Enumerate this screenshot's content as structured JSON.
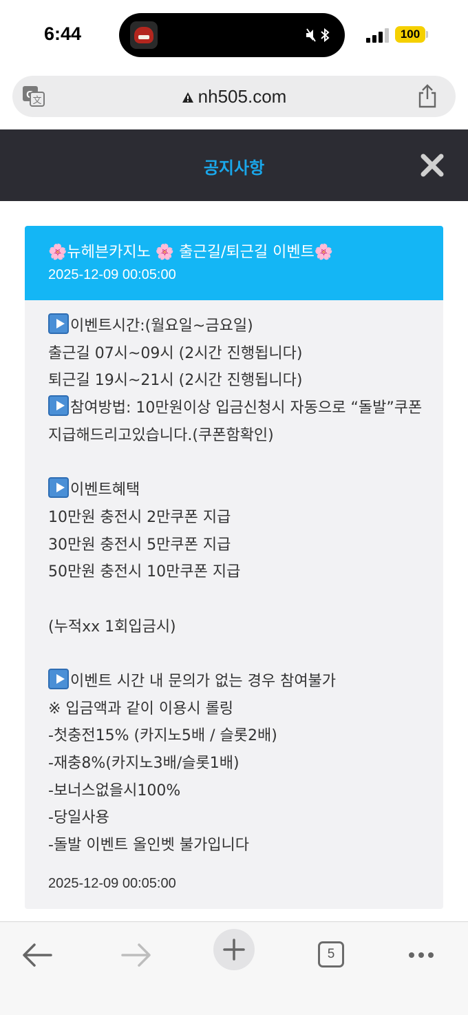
{
  "status_bar": {
    "time": "6:44",
    "battery": "100"
  },
  "browser": {
    "url": "nh505.com"
  },
  "modal": {
    "title": "공지사항"
  },
  "notice": {
    "title_segments": [
      "🌸",
      "뉴헤븐카지노 ",
      "🌸",
      " 출근길/퇴근길 이벤트",
      "🌸"
    ],
    "date": "2025-12-09 00:05:00",
    "body": [
      {
        "play": true,
        "text": "이벤트시간:(월요일~금요일)"
      },
      {
        "play": false,
        "text": "출근길 07시~09시 (2시간 진행됩니다)"
      },
      {
        "play": false,
        "text": "퇴근길 19시~21시 (2시간 진행됩니다)"
      },
      {
        "play": true,
        "text": "참여방법: 10만원이상 입금신청시  자동으로 “돌발”쿠폰 지급해드리고있습니다.(쿠폰함확인)",
        "wrap": true
      },
      {
        "play": false,
        "text": ""
      },
      {
        "play": true,
        "text": "이벤트혜택"
      },
      {
        "play": false,
        "text": "10만원 충전시 2만쿠폰 지급"
      },
      {
        "play": false,
        "text": "30만원 충전시 5만쿠폰 지급"
      },
      {
        "play": false,
        "text": "50만원 충전시 10만쿠폰 지급"
      },
      {
        "play": false,
        "text": ""
      },
      {
        "play": false,
        "text": "(누적xx 1회입금시)"
      },
      {
        "play": false,
        "text": ""
      },
      {
        "play": true,
        "text": "이벤트 시간 내 문의가 없는 경우 참여불가"
      },
      {
        "play": false,
        "text": "※ 입금액과 같이 이용시 롤링"
      },
      {
        "play": false,
        "text": "-첫충전15% (카지노5배 / 슬롯2배)"
      },
      {
        "play": false,
        "text": "-재충8%(카지노3배/슬롯1배)"
      },
      {
        "play": false,
        "text": "-보너스없을시100%"
      },
      {
        "play": false,
        "text": "-당일사용"
      },
      {
        "play": false,
        "text": "-돌발 이벤트 올인벳 불가입니다"
      }
    ],
    "footer_date": "2025-12-09 00:05:00"
  },
  "toolbar": {
    "tab_count": "5"
  },
  "colors": {
    "header_bg": "#2c2c33",
    "title_accent": "#1aa7ea",
    "notice_head_bg": "#14b6f5",
    "card_bg": "#f2f2f4"
  },
  "icons": [
    "translate-icon",
    "warning-icon",
    "share-icon",
    "close-icon",
    "back-arrow-icon",
    "forward-arrow-icon",
    "plus-icon",
    "tabs-icon",
    "more-icon",
    "bluetooth-icon",
    "speaker-icon",
    "signal-icon",
    "play-icon",
    "cherry-blossom-icon"
  ]
}
